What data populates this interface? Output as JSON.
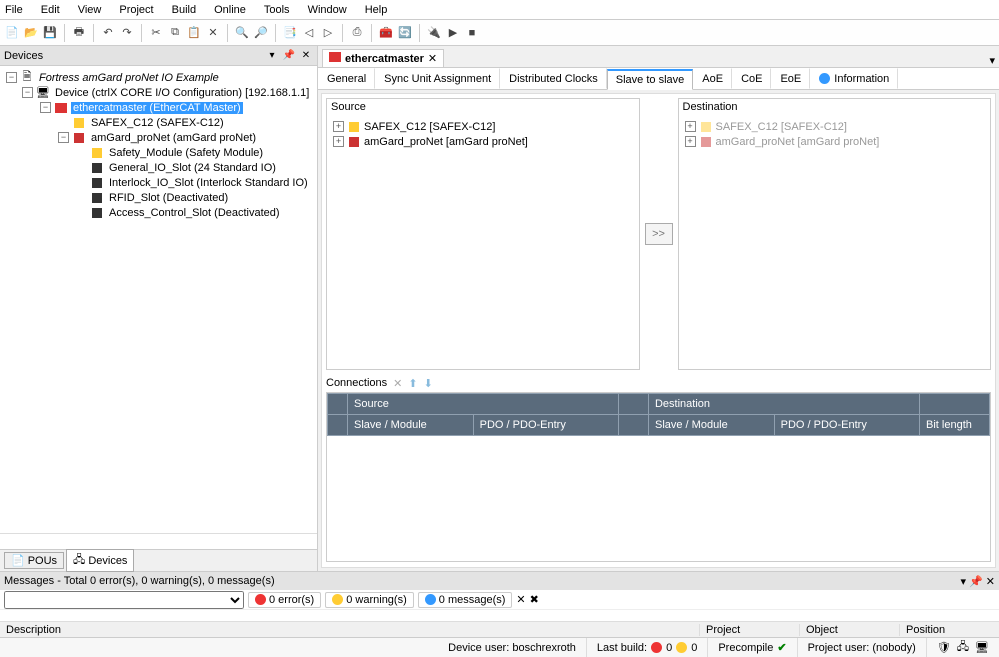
{
  "menubar": [
    "File",
    "Edit",
    "View",
    "Project",
    "Build",
    "Online",
    "Tools",
    "Window",
    "Help"
  ],
  "panels": {
    "devices": {
      "title": "Devices",
      "tree": {
        "root": "Fortress amGard proNet IO Example",
        "device": "Device (ctrlX CORE I/O Configuration) [192.168.1.1]",
        "master": "ethercatmaster (EtherCAT Master)",
        "safex": "SAFEX_C12 (SAFEX-C12)",
        "amgard": "amGard_proNet (amGard proNet)",
        "slots": [
          "Safety_Module (Safety Module)",
          "General_IO_Slot (24 Standard IO)",
          "Interlock_IO_Slot (Interlock Standard IO)",
          "RFID_Slot (Deactivated)",
          "Access_Control_Slot (Deactivated)"
        ]
      },
      "bottom_tabs": {
        "pous": "POUs",
        "devices": "Devices"
      }
    }
  },
  "editor": {
    "tab": "ethercatmaster",
    "subtabs": [
      "General",
      "Sync Unit Assignment",
      "Distributed Clocks",
      "Slave to slave",
      "AoE",
      "CoE",
      "EoE",
      "Information"
    ],
    "active_sub": 3,
    "source_label": "Source",
    "dest_label": "Destination",
    "src_items": [
      "SAFEX_C12 [SAFEX-C12]",
      "amGard_proNet [amGard proNet]"
    ],
    "dst_items": [
      "SAFEX_C12 [SAFEX-C12]",
      "amGard_proNet [amGard proNet]"
    ],
    "move_btn": ">>",
    "connections_label": "Connections",
    "table": {
      "group1": "Source",
      "group2": "Destination",
      "cols": [
        "Slave / Module",
        "PDO / PDO-Entry",
        "",
        "Slave / Module",
        "PDO / PDO-Entry",
        "Bit length"
      ]
    }
  },
  "messages": {
    "title": "Messages - Total 0 error(s), 0 warning(s), 0 message(s)",
    "errors": "0 error(s)",
    "warnings": "0 warning(s)",
    "msgs": "0 message(s)",
    "cols": {
      "desc": "Description",
      "project": "Project",
      "object": "Object",
      "position": "Position"
    }
  },
  "status": {
    "device_user": "Device user: boschrexroth",
    "last_build_label": "Last build:",
    "last_build_errors": "0",
    "last_build_warnings": "0",
    "precompile": "Precompile",
    "project_user": "Project user: (nobody)"
  }
}
